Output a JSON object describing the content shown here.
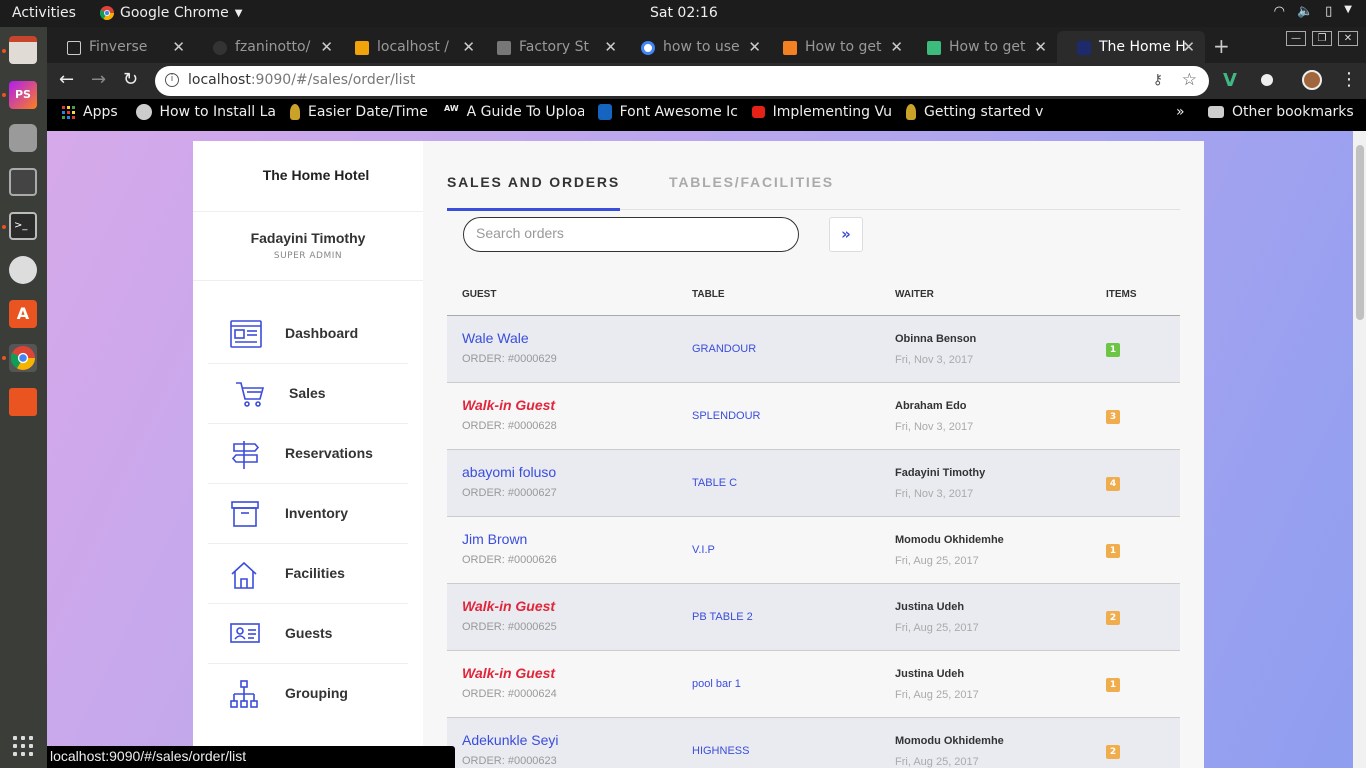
{
  "system": {
    "activities": "Activities",
    "app_name": "Google Chrome",
    "clock": "Sat 02:16"
  },
  "browser": {
    "tabs": [
      {
        "title": "Finverse",
        "fav_color": "#ffffff"
      },
      {
        "title": "fzaninotto/",
        "fav_color": "#333333"
      },
      {
        "title": "localhost /",
        "fav_color": "#f0a30a"
      },
      {
        "title": "Factory St",
        "fav_color": "#777777"
      },
      {
        "title": "how to use",
        "fav_color": "#4285f4"
      },
      {
        "title": "How to get",
        "fav_color": "#f48024"
      },
      {
        "title": "How to get",
        "fav_color": "#3dbb7d"
      },
      {
        "title": "The Home H",
        "fav_color": "#1d2a6b"
      }
    ],
    "url_host": "localhost",
    "url_rest": ":9090/#/sales/order/list",
    "bookmarks": [
      {
        "label": "Apps",
        "icon": "apps-icon"
      },
      {
        "label": "How to Install La",
        "icon": "globe-icon"
      },
      {
        "label": "Easier Date/Time",
        "icon": "bulb-icon"
      },
      {
        "label": "A Guide To Uploa",
        "icon": "aw-icon"
      },
      {
        "label": "Font Awesome Ic",
        "icon": "flag-icon"
      },
      {
        "label": "Implementing Vu",
        "icon": "youtube-icon"
      },
      {
        "label": "Getting started v",
        "icon": "bulb-icon"
      }
    ],
    "more_bookmarks": "»",
    "other_bookmarks": "Other bookmarks",
    "status_url": "localhost:9090/#/sales/order/list"
  },
  "sidebar": {
    "hotel_name": "The Home Hotel",
    "user_name": "Fadayini Timothy",
    "user_role": "SUPER ADMIN",
    "items": [
      {
        "label": "Dashboard",
        "icon": "dashboard-icon"
      },
      {
        "label": "Sales",
        "icon": "cart-icon"
      },
      {
        "label": "Reservations",
        "icon": "signpost-icon"
      },
      {
        "label": "Inventory",
        "icon": "archive-box-icon"
      },
      {
        "label": "Facilities",
        "icon": "home-icon"
      },
      {
        "label": "Guests",
        "icon": "id-card-icon"
      },
      {
        "label": "Grouping",
        "icon": "hierarchy-icon"
      }
    ]
  },
  "main": {
    "tabs": [
      "SALES AND ORDERS",
      "TABLES/FACILITIES"
    ],
    "search_placeholder": "Search orders",
    "go_label": "»",
    "columns": [
      "GUEST",
      "TABLE",
      "WAITER",
      "ITEMS"
    ],
    "rows": [
      {
        "guest": "Wale Wale",
        "walkin": false,
        "order": "ORDER: #0000629",
        "table": "GRANDOUR",
        "waiter": "Obinna Benson",
        "date": "Fri, Nov 3, 2017",
        "items": "1",
        "badge_color": "#6cc644"
      },
      {
        "guest": "Walk-in Guest",
        "walkin": true,
        "order": "ORDER: #0000628",
        "table": "SPLENDOUR",
        "waiter": "Abraham Edo",
        "date": "Fri, Nov 3, 2017",
        "items": "3",
        "badge_color": "#f0ad4e"
      },
      {
        "guest": "abayomi foluso",
        "walkin": false,
        "order": "ORDER: #0000627",
        "table": "TABLE C",
        "waiter": "Fadayini Timothy",
        "date": "Fri, Nov 3, 2017",
        "items": "4",
        "badge_color": "#f0ad4e"
      },
      {
        "guest": "Jim Brown",
        "walkin": false,
        "order": "ORDER: #0000626",
        "table": "V.I.P",
        "waiter": "Momodu Okhidemhe",
        "date": "Fri, Aug 25, 2017",
        "items": "1",
        "badge_color": "#f0ad4e"
      },
      {
        "guest": "Walk-in Guest",
        "walkin": true,
        "order": "ORDER: #0000625",
        "table": "PB TABLE 2",
        "waiter": "Justina Udeh",
        "date": "Fri, Aug 25, 2017",
        "items": "2",
        "badge_color": "#f0ad4e"
      },
      {
        "guest": "Walk-in Guest",
        "walkin": true,
        "order": "ORDER: #0000624",
        "table": "pool bar 1",
        "waiter": "Justina Udeh",
        "date": "Fri, Aug 25, 2017",
        "items": "1",
        "badge_color": "#f0ad4e"
      },
      {
        "guest": "Adekunkle Seyi",
        "walkin": false,
        "order": "ORDER: #0000623",
        "table": "HIGHNESS",
        "waiter": "Momodu Okhidemhe",
        "date": "Fri, Aug 25, 2017",
        "items": "2",
        "badge_color": "#f0ad4e"
      }
    ]
  }
}
